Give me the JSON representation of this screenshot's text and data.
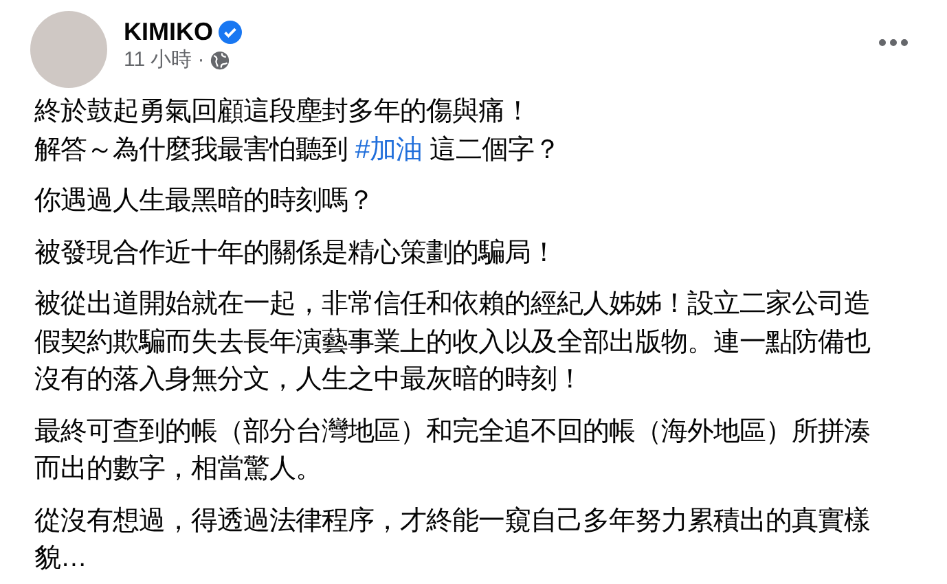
{
  "post": {
    "author": "KIMIKO",
    "verified": true,
    "time": "11 小時",
    "separator": "·",
    "paragraphs": [
      {
        "segments": [
          {
            "kind": "text",
            "text": "終於鼓起勇氣回顧這段塵封多年的傷與痛！"
          },
          {
            "kind": "break"
          },
          {
            "kind": "text",
            "text": "解答～為什麼我最害怕聽到 "
          },
          {
            "kind": "hashtag",
            "text": "#加油"
          },
          {
            "kind": "text",
            "text": " 這二個字？"
          }
        ]
      },
      {
        "segments": [
          {
            "kind": "text",
            "text": "你遇過人生最黑暗的時刻嗎？"
          }
        ]
      },
      {
        "segments": [
          {
            "kind": "text",
            "text": "被發現合作近十年的關係是精心策劃的騙局！"
          }
        ]
      },
      {
        "segments": [
          {
            "kind": "text",
            "text": "被從出道開始就在一起，非常信任和依賴的經紀人姊姊！設立二家公司造假契約欺騙而失去長年演藝事業上的收入以及全部出版物。連一點防備也沒有的落入身無分文，人生之中最灰暗的時刻！"
          }
        ]
      },
      {
        "segments": [
          {
            "kind": "text",
            "text": "最終可查到的帳（部分台灣地區）和完全追不回的帳（海外地區）所拼湊而出的數字，相當驚人。"
          }
        ]
      },
      {
        "segments": [
          {
            "kind": "text",
            "text": "從沒有想過，得透過法律程序，才終能一窺自己多年努力累積出的真實樣貌…"
          }
        ]
      }
    ]
  }
}
